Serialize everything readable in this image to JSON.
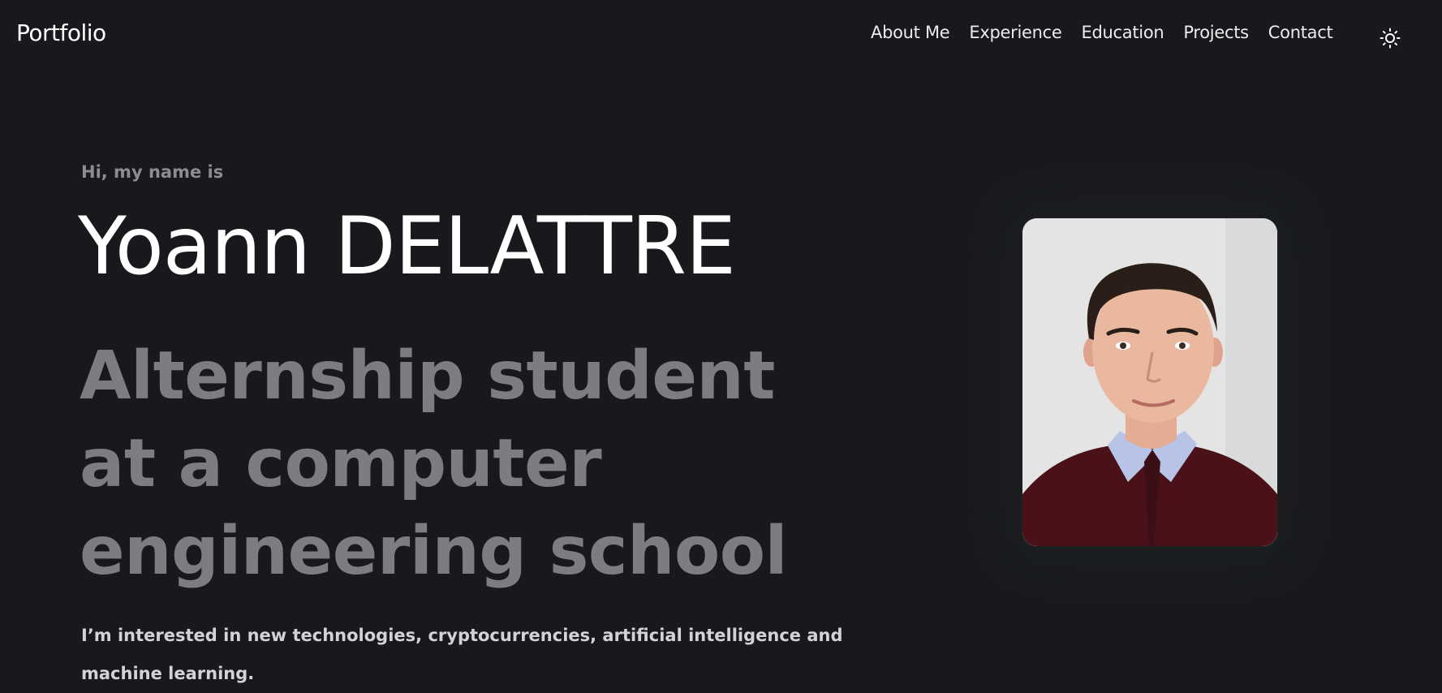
{
  "header": {
    "brand": "Portfolio",
    "nav": [
      {
        "label": "About Me"
      },
      {
        "label": "Experience"
      },
      {
        "label": "Education"
      },
      {
        "label": "Projects"
      },
      {
        "label": "Contact"
      }
    ],
    "theme_toggle_icon": "sun-icon"
  },
  "hero": {
    "greeting": "Hi, my name is",
    "name": "Yoann DELATTRE",
    "tagline": "Alternship student at a computer engineering school",
    "bio": "I’m interested in new technologies, cryptocurrencies, artificial intelligence and machine learning.",
    "photo_icon": "profile-photo"
  },
  "colors": {
    "background": "#18191c",
    "text_primary": "#ffffff",
    "text_muted": "#7c7d80"
  }
}
